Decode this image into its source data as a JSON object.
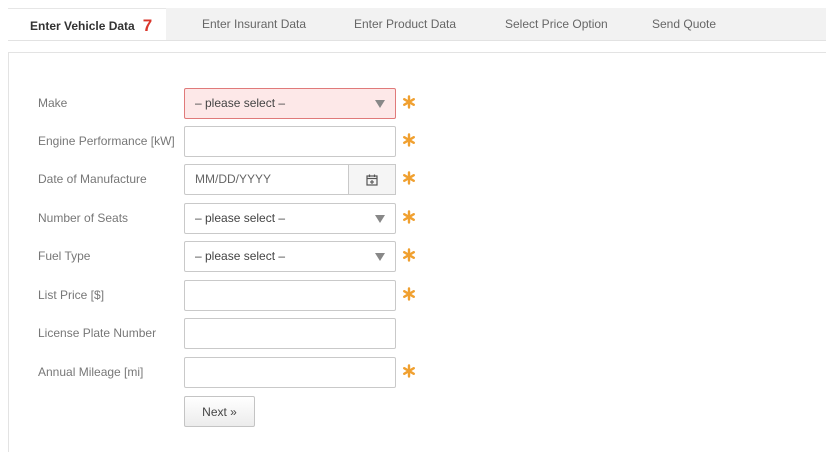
{
  "tabs": [
    {
      "label": "Enter Vehicle Data",
      "count": "7",
      "active": true
    },
    {
      "label": "Enter Insurant Data"
    },
    {
      "label": "Enter Product Data"
    },
    {
      "label": "Select Price Option"
    },
    {
      "label": "Send Quote"
    }
  ],
  "form": {
    "make": {
      "label": "Make",
      "value": "– please select –",
      "required": true,
      "state": "error"
    },
    "engine_performance": {
      "label": "Engine Performance [kW]",
      "value": "",
      "required": true
    },
    "date_of_manufacture": {
      "label": "Date of Manufacture",
      "placeholder": "MM/DD/YYYY",
      "required": true
    },
    "number_of_seats": {
      "label": "Number of Seats",
      "value": "– please select –",
      "required": true
    },
    "fuel_type": {
      "label": "Fuel Type",
      "value": "– please select –",
      "required": true
    },
    "list_price": {
      "label": "List Price [$]",
      "value": "",
      "required": true
    },
    "license_plate_number": {
      "label": "License Plate Number",
      "value": "",
      "required": false
    },
    "annual_mileage": {
      "label": "Annual Mileage [mi]",
      "value": "",
      "required": true
    }
  },
  "next_label": "Next »",
  "colors": {
    "required_star": "#f0a030",
    "error_bg": "#fde8e8",
    "error_border": "#e07a7a",
    "count": "#d9362b"
  },
  "icons": {
    "calendar": "calendar-icon",
    "required": "asterisk-icon",
    "dropdown": "chevron-down-icon"
  }
}
